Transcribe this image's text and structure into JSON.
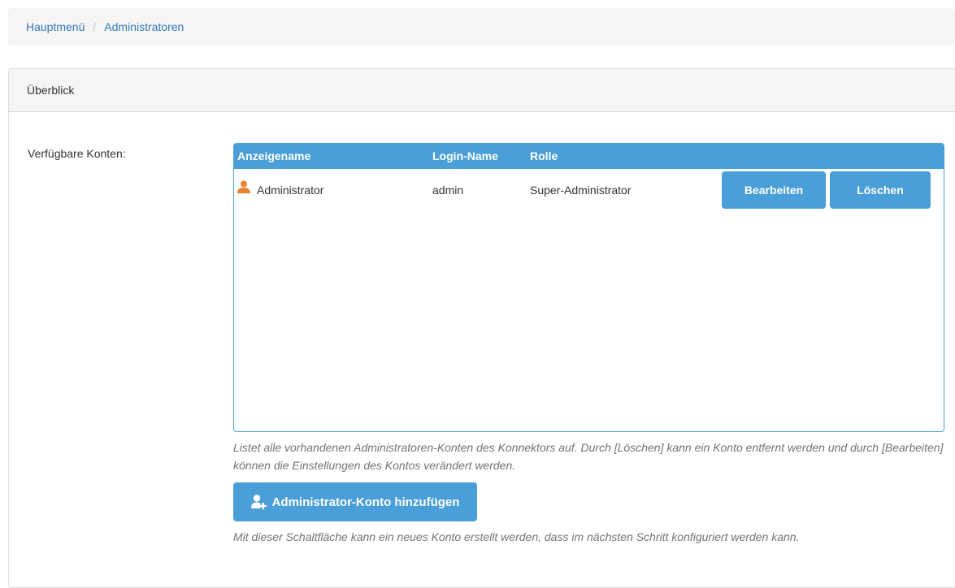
{
  "breadcrumb": {
    "home": "Hauptmenü",
    "separator": "/",
    "current": "Administratoren"
  },
  "panel": {
    "title": "Überblick",
    "field_label": "Verfügbare Konten:"
  },
  "table": {
    "headers": [
      "Anzeigename",
      "Login-Name",
      "Rolle"
    ],
    "rows": [
      {
        "display_name": "Administrator",
        "login_name": "admin",
        "role": "Super-Administrator",
        "icon": "user-icon",
        "edit_label": "Bearbeiten",
        "delete_label": "Löschen"
      }
    ]
  },
  "help_list": "Listet alle vorhandenen Administratoren-Konten des Konnektors auf. Durch [Löschen] kann ein Konto entfernt werden und durch [Bearbeiten] können die Einstellungen des Kontos verändert werden.",
  "add_button": {
    "label": "Administrator-Konto hinzufügen",
    "icon": "add-user-icon"
  },
  "help_add": "Mit dieser Schaltfläche kann ein neues Konto erstellt werden, dass im nächsten Schritt konfiguriert werden kann.",
  "colors": {
    "accent": "#4a9fd8",
    "link": "#337ab7",
    "user_icon": "#e8822f"
  }
}
